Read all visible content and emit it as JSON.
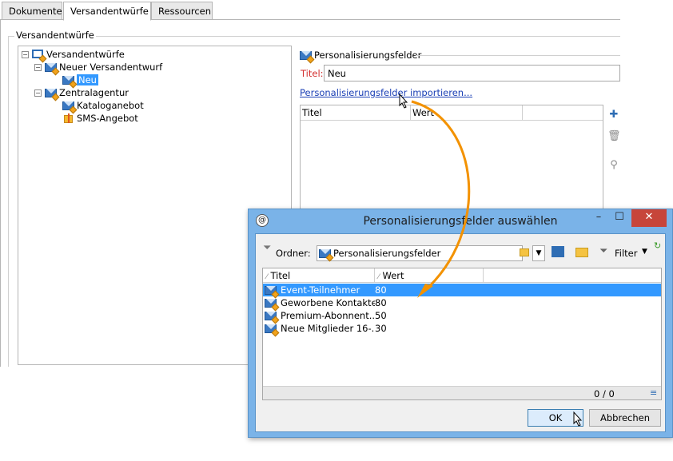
{
  "tabs": [
    {
      "label": "Dokumente"
    },
    {
      "label": "Versandentwürfe"
    },
    {
      "label": "Ressourcen"
    }
  ],
  "group": {
    "label": "Versandentwürfe"
  },
  "tree": {
    "root": "Versandentwürfe",
    "child1": "Neuer Versandentwurf",
    "child1_1": "Neu",
    "child2": "Zentralagentur",
    "child2_1": "Kataloganebot",
    "child2_2": "SMS-Angebot"
  },
  "right_panel": {
    "section_title": "Personalisierungsfelder",
    "titel_label": "Titel:",
    "titel_value": "Neu",
    "import_link": "Personalisierungsfelder importieren...",
    "columns": [
      "Titel",
      "Wert"
    ]
  },
  "dialog": {
    "title": "Personalisierungsfelder auswählen",
    "ordner_label": "Ordner:",
    "ordner_value": "Personalisierungsfelder",
    "filter_label": "Filter",
    "columns": [
      "Titel",
      "Wert"
    ],
    "rows": [
      {
        "title": "Event-Teilnehmer",
        "value": "80"
      },
      {
        "title": "Geworbene Kontakte",
        "value": "80"
      },
      {
        "title": "Premium-Abonnent...",
        "value": "50"
      },
      {
        "title": "Neue Mitglieder 16-...",
        "value": "30"
      }
    ],
    "counter": "0 / 0",
    "ok_label": "OK",
    "cancel_label": "Abbrechen"
  },
  "colors": {
    "accent": "#3399ff",
    "arrow": "#f39200",
    "link": "#1a3fb5",
    "titlebar": "#7ab3e8",
    "close": "#c7453a"
  }
}
